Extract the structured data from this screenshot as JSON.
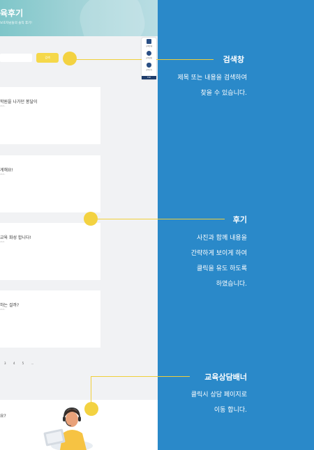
{
  "hero": {
    "title": "육후기",
    "subtitle": "보호자님들의 솔직 후기!"
  },
  "search": {
    "button_label": "검색"
  },
  "reviews": [
    {
      "title": "학원을 나가던 봉달이",
      "meta": "2024.."
    },
    {
      "title": "게해요!",
      "meta": "2024.."
    },
    {
      "title": "교육 화성 합니다!",
      "meta": "2024"
    },
    {
      "title": "하는 걸까?",
      "meta": "2024.."
    }
  ],
  "pagination": [
    "3",
    "4",
    "5",
    "..."
  ],
  "banner": {
    "text": "요?"
  },
  "quick_menu": {
    "items": [
      {
        "icon": "book-icon",
        "label": "교육안내"
      },
      {
        "icon": "chat-icon",
        "label": "교육상담"
      },
      {
        "icon": "paw-icon",
        "label": "교육후기"
      }
    ],
    "top_label": "TOP"
  },
  "annotations": {
    "search": {
      "title": "검색창",
      "desc": [
        "제목 또는 내용을 검색하여",
        "찾을 수 있습니다."
      ]
    },
    "review": {
      "title": "후기",
      "desc": [
        "사진과 함께 내용을",
        "간략하게 보이게 하여",
        "클릭을 유도 하도록",
        "하였습니다."
      ]
    },
    "banner": {
      "title": "교육상담배너",
      "desc": [
        "클릭시 상담 페이지로",
        "이동 합니다."
      ]
    }
  },
  "colors": {
    "background": "#2a89c9",
    "accent_yellow": "#f3d241",
    "page": "#f1f2f4"
  }
}
